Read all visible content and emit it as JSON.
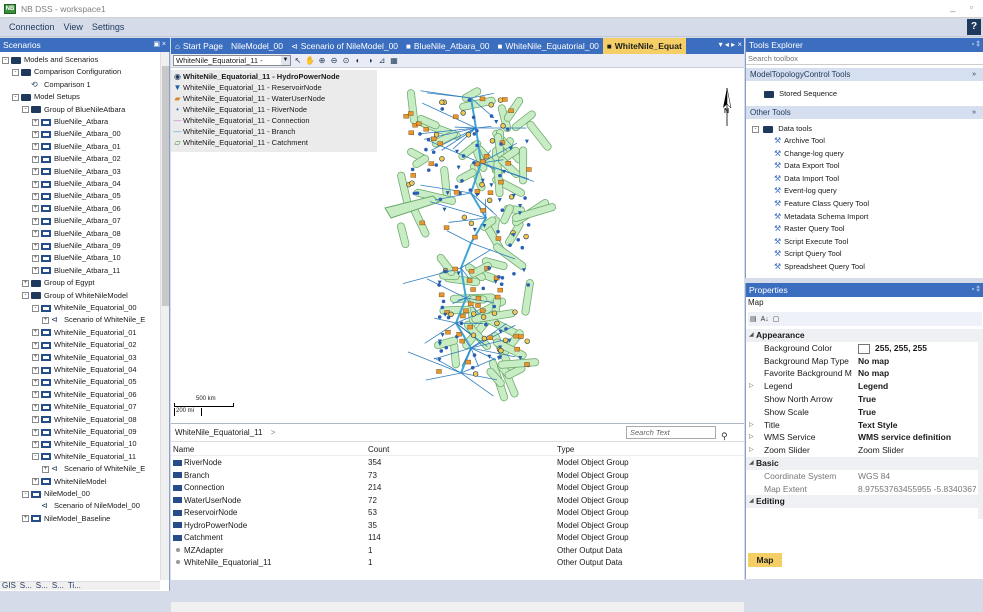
{
  "window": {
    "title": "NB DSS - workspace1",
    "app_icon": "nbdss-icon"
  },
  "menu": [
    "Connection",
    "View",
    "Settings"
  ],
  "scenarios": {
    "header": "Scenarios",
    "pin": "▣ ×",
    "tree": [
      {
        "label": "Models and Scenarios",
        "level": 0,
        "icon": "root",
        "exp": "-"
      },
      {
        "label": "Comparison Configuration",
        "level": 1,
        "icon": "folder",
        "exp": "-"
      },
      {
        "label": "Comparison 1",
        "level": 2,
        "icon": "compare",
        "exp": ""
      },
      {
        "label": "Model Setups",
        "level": 1,
        "icon": "folder",
        "exp": "-"
      },
      {
        "label": "Group of BlueNileAtbara",
        "level": 2,
        "icon": "folder",
        "exp": "-"
      },
      {
        "label": "BlueNile_Atbara",
        "level": 3,
        "icon": "model",
        "exp": "+"
      },
      {
        "label": "BlueNile_Atbara_00",
        "level": 3,
        "icon": "model",
        "exp": "+"
      },
      {
        "label": "BlueNile_Atbara_01",
        "level": 3,
        "icon": "model",
        "exp": "+"
      },
      {
        "label": "BlueNile_Atbara_02",
        "level": 3,
        "icon": "model",
        "exp": "+"
      },
      {
        "label": "BlueNile_Atbara_03",
        "level": 3,
        "icon": "model",
        "exp": "+"
      },
      {
        "label": "BlueNile_Atbara_04",
        "level": 3,
        "icon": "model",
        "exp": "+"
      },
      {
        "label": "BlueNile_Atbara_05",
        "level": 3,
        "icon": "model",
        "exp": "+"
      },
      {
        "label": "BlueNile_Atbara_06",
        "level": 3,
        "icon": "model",
        "exp": "+"
      },
      {
        "label": "BlueNile_Atbara_07",
        "level": 3,
        "icon": "model",
        "exp": "+"
      },
      {
        "label": "BlueNile_Atbara_08",
        "level": 3,
        "icon": "model",
        "exp": "+"
      },
      {
        "label": "BlueNile_Atbara_09",
        "level": 3,
        "icon": "model",
        "exp": "+"
      },
      {
        "label": "BlueNile_Atbara_10",
        "level": 3,
        "icon": "model",
        "exp": "+"
      },
      {
        "label": "BlueNile_Atbara_11",
        "level": 3,
        "icon": "model",
        "exp": "+"
      },
      {
        "label": "Group of Egypt",
        "level": 2,
        "icon": "folder",
        "exp": "+"
      },
      {
        "label": "Group of WhiteNileModel",
        "level": 2,
        "icon": "folder",
        "exp": "-"
      },
      {
        "label": "WhiteNile_Equatorial_00",
        "level": 3,
        "icon": "model",
        "exp": "-"
      },
      {
        "label": "Scenario of WhiteNile_E",
        "level": 4,
        "icon": "scenario",
        "exp": "+"
      },
      {
        "label": "WhiteNile_Equatorial_01",
        "level": 3,
        "icon": "model",
        "exp": "+"
      },
      {
        "label": "WhiteNile_Equatorial_02",
        "level": 3,
        "icon": "model",
        "exp": "+"
      },
      {
        "label": "WhiteNile_Equatorial_03",
        "level": 3,
        "icon": "model",
        "exp": "+"
      },
      {
        "label": "WhiteNile_Equatorial_04",
        "level": 3,
        "icon": "model",
        "exp": "+"
      },
      {
        "label": "WhiteNile_Equatorial_05",
        "level": 3,
        "icon": "model",
        "exp": "+"
      },
      {
        "label": "WhiteNile_Equatorial_06",
        "level": 3,
        "icon": "model",
        "exp": "+"
      },
      {
        "label": "WhiteNile_Equatorial_07",
        "level": 3,
        "icon": "model",
        "exp": "+"
      },
      {
        "label": "WhiteNile_Equatorial_08",
        "level": 3,
        "icon": "model",
        "exp": "+"
      },
      {
        "label": "WhiteNile_Equatorial_09",
        "level": 3,
        "icon": "model",
        "exp": "+"
      },
      {
        "label": "WhiteNile_Equatorial_10",
        "level": 3,
        "icon": "model",
        "exp": "+"
      },
      {
        "label": "WhiteNile_Equatorial_11",
        "level": 3,
        "icon": "model",
        "exp": "-"
      },
      {
        "label": "Scenario of WhiteNile_E",
        "level": 4,
        "icon": "scenario",
        "exp": "+"
      },
      {
        "label": "WhiteNileModel",
        "level": 3,
        "icon": "model",
        "exp": "+"
      },
      {
        "label": "NileModel_00",
        "level": 2,
        "icon": "model",
        "exp": "-"
      },
      {
        "label": "Scenario of NileModel_00",
        "level": 3,
        "icon": "scenario",
        "exp": ""
      },
      {
        "label": "NileModel_Baseline",
        "level": 2,
        "icon": "model",
        "exp": "+"
      }
    ],
    "bottom_tabs": [
      "GIS",
      "S...",
      "S...",
      "S...",
      "Ti..."
    ]
  },
  "doc_tabs": [
    {
      "label": "Start Page",
      "icon": "home-icon",
      "active": false
    },
    {
      "label": "NileModel_00",
      "icon": "",
      "active": false
    },
    {
      "label": "Scenario of NileModel_00",
      "icon": "scenario-icon",
      "active": false
    },
    {
      "label": "BlueNile_Atbara_00",
      "icon": "model-icon",
      "active": false
    },
    {
      "label": "WhiteNile_Equatorial_00",
      "icon": "model-icon",
      "active": false
    },
    {
      "label": "WhiteNile_Equat",
      "icon": "model-icon",
      "active": true
    }
  ],
  "map_toolbar": {
    "layer": "WhiteNile_Equatorial_11 -"
  },
  "legend": [
    {
      "label": "WhiteNile_Equatorial_11 - HydroPowerNode",
      "sym": "◉",
      "color": "#1e395b",
      "bold": true
    },
    {
      "label": "WhiteNile_Equatorial_11 - ReservoirNode",
      "sym": "▼",
      "color": "#1e5ea8",
      "bold": false
    },
    {
      "label": "WhiteNile_Equatorial_11 - WaterUserNode",
      "sym": "▰",
      "color": "#d08a2c",
      "bold": false
    },
    {
      "label": "WhiteNile_Equatorial_11 - RiverNode",
      "sym": "•",
      "color": "#3c6ebf",
      "bold": false
    },
    {
      "label": "WhiteNile_Equatorial_11 - Connection",
      "sym": "—",
      "color": "#c97bc9",
      "bold": false
    },
    {
      "label": "WhiteNile_Equatorial_11 - Branch",
      "sym": "—",
      "color": "#3fa6d4",
      "bold": false
    },
    {
      "label": "WhiteNile_Equatorial_11 - Catchment",
      "sym": "▱",
      "color": "#3a8f3a",
      "bold": false
    }
  ],
  "map": {
    "north_label": "N",
    "scale_km": "500 km",
    "scale_mi": "200 mi"
  },
  "table": {
    "breadcrumb": "WhiteNile_Equatorial_11",
    "breadcrumb_arrow": ">",
    "search_placeholder": "Search Text",
    "columns": [
      "Name",
      "Count",
      "Type"
    ],
    "rows": [
      {
        "name": "RiverNode",
        "count": "354",
        "type": "Model Object Group",
        "icon": "group"
      },
      {
        "name": "Branch",
        "count": "73",
        "type": "Model Object Group",
        "icon": "group"
      },
      {
        "name": "Connection",
        "count": "214",
        "type": "Model Object Group",
        "icon": "group"
      },
      {
        "name": "WaterUserNode",
        "count": "72",
        "type": "Model Object Group",
        "icon": "group"
      },
      {
        "name": "ReservoirNode",
        "count": "53",
        "type": "Model Object Group",
        "icon": "group"
      },
      {
        "name": "HydroPowerNode",
        "count": "35",
        "type": "Model Object Group",
        "icon": "group"
      },
      {
        "name": "Catchment",
        "count": "114",
        "type": "Model Object Group",
        "icon": "group"
      },
      {
        "name": "MZAdapter",
        "count": "1",
        "type": "Other Output Data",
        "icon": "dot"
      },
      {
        "name": "WhiteNile_Equatorial_11",
        "count": "1",
        "type": "Other Output Data",
        "icon": "dot"
      }
    ]
  },
  "tools": {
    "header": "Tools Explorer",
    "search_placeholder": "Search toolbox",
    "sections": [
      {
        "label": "ModelTopologyControl Tools",
        "chev": "»"
      },
      {
        "label": "Other Tools",
        "chev": "»"
      }
    ],
    "stored_sequence": "Stored Sequence",
    "data_tools": "Data tools",
    "items": [
      "Archive Tool",
      "Change-log query",
      "Data Export Tool",
      "Data Import Tool",
      "Event-log query",
      "Feature Class Query Tool",
      "Metadata Schema Import",
      "Raster Query Tool",
      "Script Execute Tool",
      "Script Query Tool",
      "Spreadsheet Query Tool"
    ]
  },
  "properties": {
    "header": "Properties",
    "object": "Map",
    "rows": [
      {
        "kind": "cat",
        "name": "Appearance",
        "tri": "◢"
      },
      {
        "kind": "prop",
        "name": "Background Color",
        "value": "255, 255, 255",
        "bold": true,
        "swatch": true
      },
      {
        "kind": "prop",
        "name": "Background Map Type",
        "value": "No map",
        "bold": true
      },
      {
        "kind": "prop",
        "name": "Favorite Background M",
        "value": "No map",
        "bold": true
      },
      {
        "kind": "prop",
        "name": "Legend",
        "value": "Legend",
        "bold": true,
        "tri": "▷"
      },
      {
        "kind": "prop",
        "name": "Show North Arrow",
        "value": "True",
        "bold": true
      },
      {
        "kind": "prop",
        "name": "Show Scale",
        "value": "True",
        "bold": true
      },
      {
        "kind": "prop",
        "name": "Title",
        "value": "Text Style",
        "bold": true,
        "tri": "▷"
      },
      {
        "kind": "prop",
        "name": "WMS Service",
        "value": "WMS service definition",
        "bold": true,
        "tri": "▷"
      },
      {
        "kind": "prop",
        "name": "Zoom Slider",
        "value": "Zoom Slider",
        "bold": false,
        "tri": "▷"
      },
      {
        "kind": "cat",
        "name": "Basic",
        "tri": "◢"
      },
      {
        "kind": "prop",
        "name": "Coordinate System",
        "value": "WGS 84",
        "bold": false,
        "dis": true
      },
      {
        "kind": "prop",
        "name": "Map Extent",
        "value": "8.97553763455955 -5.83403679",
        "bold": false,
        "dis": true
      },
      {
        "kind": "cat",
        "name": "Editing",
        "tri": "◢"
      }
    ],
    "bottom_tab": "Map"
  },
  "colors": {
    "accent": "#3c6ebf",
    "active_tab": "#f5cf65",
    "catchment": "#c8ecc4",
    "water_user": "#e8962e",
    "river": "#3fa6d4"
  }
}
